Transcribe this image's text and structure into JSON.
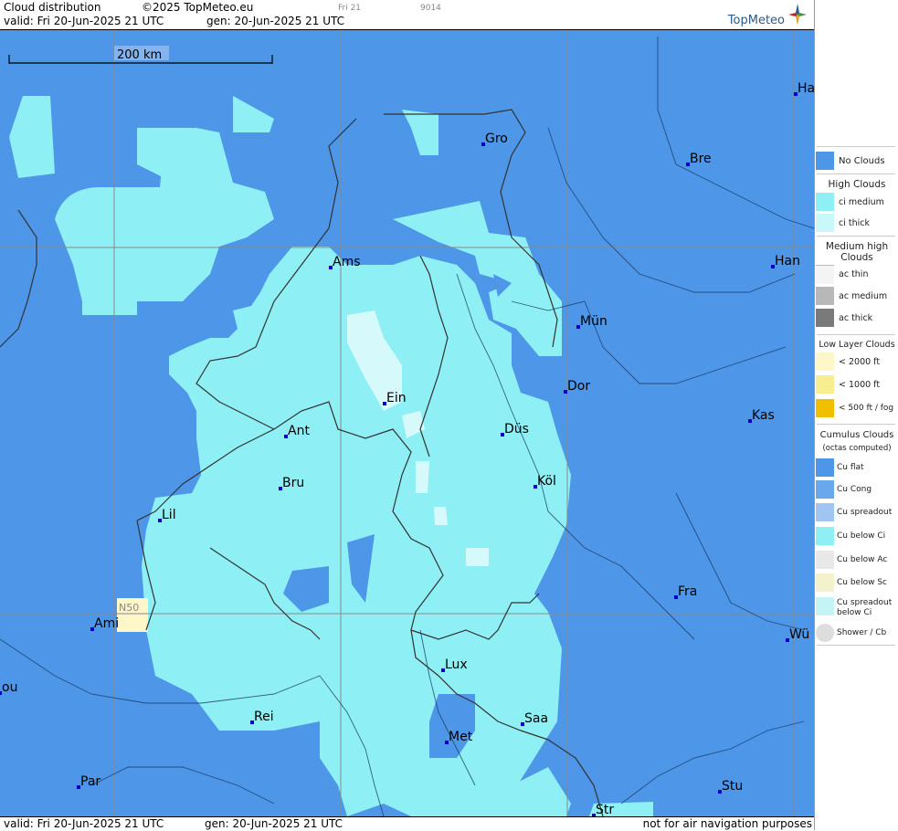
{
  "header": {
    "title": "Cloud distribution",
    "copyright": "©2025 TopMeteo.eu",
    "valid": "valid:  Fri  20-Jun-2025  21 UTC",
    "gen": "gen: 20-Jun-2025 21 UTC",
    "small_day": "Fri 21",
    "small_code": "9014",
    "logo_text": "TopMeteo"
  },
  "map": {
    "scale_label": "200 km",
    "grid_label": "N50",
    "colors": {
      "no_clouds": "#4d96e8",
      "ci_medium": "#8ef0f4",
      "ci_thick": "#d6fafc",
      "low": "#fdf6c8",
      "border": "#333"
    },
    "cities": [
      {
        "id": "ha",
        "name": "Ha"
      },
      {
        "id": "gro",
        "name": "Gro"
      },
      {
        "id": "bre",
        "name": "Bre"
      },
      {
        "id": "ams",
        "name": "Ams"
      },
      {
        "id": "han",
        "name": "Han"
      },
      {
        "id": "mun",
        "name": "Mün"
      },
      {
        "id": "dor",
        "name": "Dor"
      },
      {
        "id": "ein",
        "name": "Ein"
      },
      {
        "id": "kas",
        "name": "Kas"
      },
      {
        "id": "ant",
        "name": "Ant"
      },
      {
        "id": "dus",
        "name": "Düs"
      },
      {
        "id": "bru",
        "name": "Bru"
      },
      {
        "id": "kol",
        "name": "Köl"
      },
      {
        "id": "lil",
        "name": "Lil"
      },
      {
        "id": "fra",
        "name": "Fra"
      },
      {
        "id": "ami",
        "name": "Ami"
      },
      {
        "id": "wu",
        "name": "Wü"
      },
      {
        "id": "lux",
        "name": "Lux"
      },
      {
        "id": "rou",
        "name": "ou"
      },
      {
        "id": "rei",
        "name": "Rei"
      },
      {
        "id": "saa",
        "name": "Saa"
      },
      {
        "id": "met",
        "name": "Met"
      },
      {
        "id": "par",
        "name": "Par"
      },
      {
        "id": "stu",
        "name": "Stu"
      },
      {
        "id": "str",
        "name": "Str"
      }
    ]
  },
  "footer": {
    "valid": "valid:  Fri  20-Jun-2025  21 UTC",
    "gen": "gen: 20-Jun-2025 21 UTC",
    "disclaimer": "not for air navigation purposes"
  },
  "legend": {
    "no_clouds": "No Clouds",
    "high_head": "High Clouds",
    "ci_medium": "ci medium",
    "ci_thick": "ci thick",
    "medium_head": "Medium high Clouds",
    "ac_thin": "ac thin",
    "ac_medium": "ac medium",
    "ac_thick": "ac thick",
    "low_head": "Low Layer Clouds",
    "low_2000": "< 2000 ft",
    "low_1000": "< 1000 ft",
    "low_500": "< 500 ft / fog",
    "cu_head": "Cumulus Clouds",
    "cu_sub": "(octas computed)",
    "cu_flat": "Cu flat",
    "cu_cong": "Cu Cong",
    "cu_spreadout": "Cu spreadout",
    "cu_below_ci": "Cu below Ci",
    "cu_below_ac": "Cu below Ac",
    "cu_below_sc": "Cu below Sc",
    "cu_spreadout_below_ci": "Cu spreadout below Ci",
    "shower": "Shower / Cb"
  }
}
